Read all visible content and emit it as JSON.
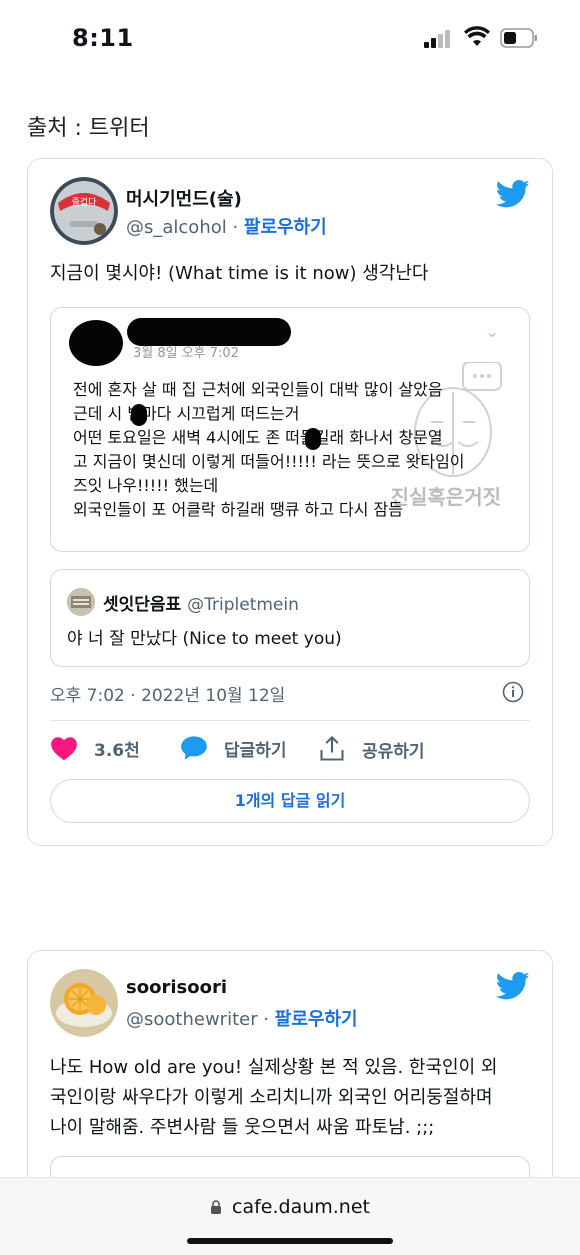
{
  "status_bar": {
    "time": "8:11"
  },
  "source_label": "출처 : 트위터",
  "tweets": [
    {
      "display_name": "머시기먼드(술)",
      "handle": "@s_alcohol",
      "separator": " · ",
      "follow_label": "팔로우하기",
      "avatar_badge": "즐겁다",
      "text": "지금이 몇시야! (What time is it now) 생각난다",
      "quoted": {
        "date": "3월 8일 오후 7:02",
        "lines": [
          "전에 혼자 살 때 집 근처에 외국인들이 대박 많이 살았음",
          "근데 시  밤마다 시끄럽게 떠드는거",
          "어떤 토요일은 새벽 4시에도 존  떠들길래 화나서 창문열",
          "고 지금이 몇신데 이렇게 떠들어!!!!! 라는 뜻으로 왓타임이",
          "즈잇 나우!!!!! 했는데",
          "외국인들이 포 어클락 하길래 땡큐 하고 다시 잠듬"
        ],
        "watermark": "진실혹은거짓"
      },
      "reply": {
        "name": "셋잇단음표",
        "handle": "@Tripletmein",
        "text": "야 너 잘 만났다 (Nice to meet you)"
      },
      "timestamp": "오후 7:02 · 2022년 10월 12일",
      "likes": "3.6천",
      "reply_label": "답글하기",
      "share_label": "공유하기",
      "read_replies_label": "1개의 답글 읽기"
    },
    {
      "display_name": "soorisoori",
      "handle": "@soothewriter",
      "separator": " · ",
      "follow_label": "팔로우하기",
      "text_lines": [
        "나도 How old are you! 실제상황 본 적 있음. 한국인이 외",
        "국인이랑 싸우다가 이렇게 소리치니까 외국인 어리둥절하며",
        "나이 말해줌. 주변사람 들 웃으면서 싸움 파토남. ;;;"
      ]
    }
  ],
  "browser": {
    "url": "cafe.daum.net"
  },
  "colors": {
    "link": "#1d6fd8",
    "twitter_blue": "#1d9bf0",
    "like_pink": "#f91880",
    "border": "#cfd9de",
    "muted_text": "#536471"
  }
}
